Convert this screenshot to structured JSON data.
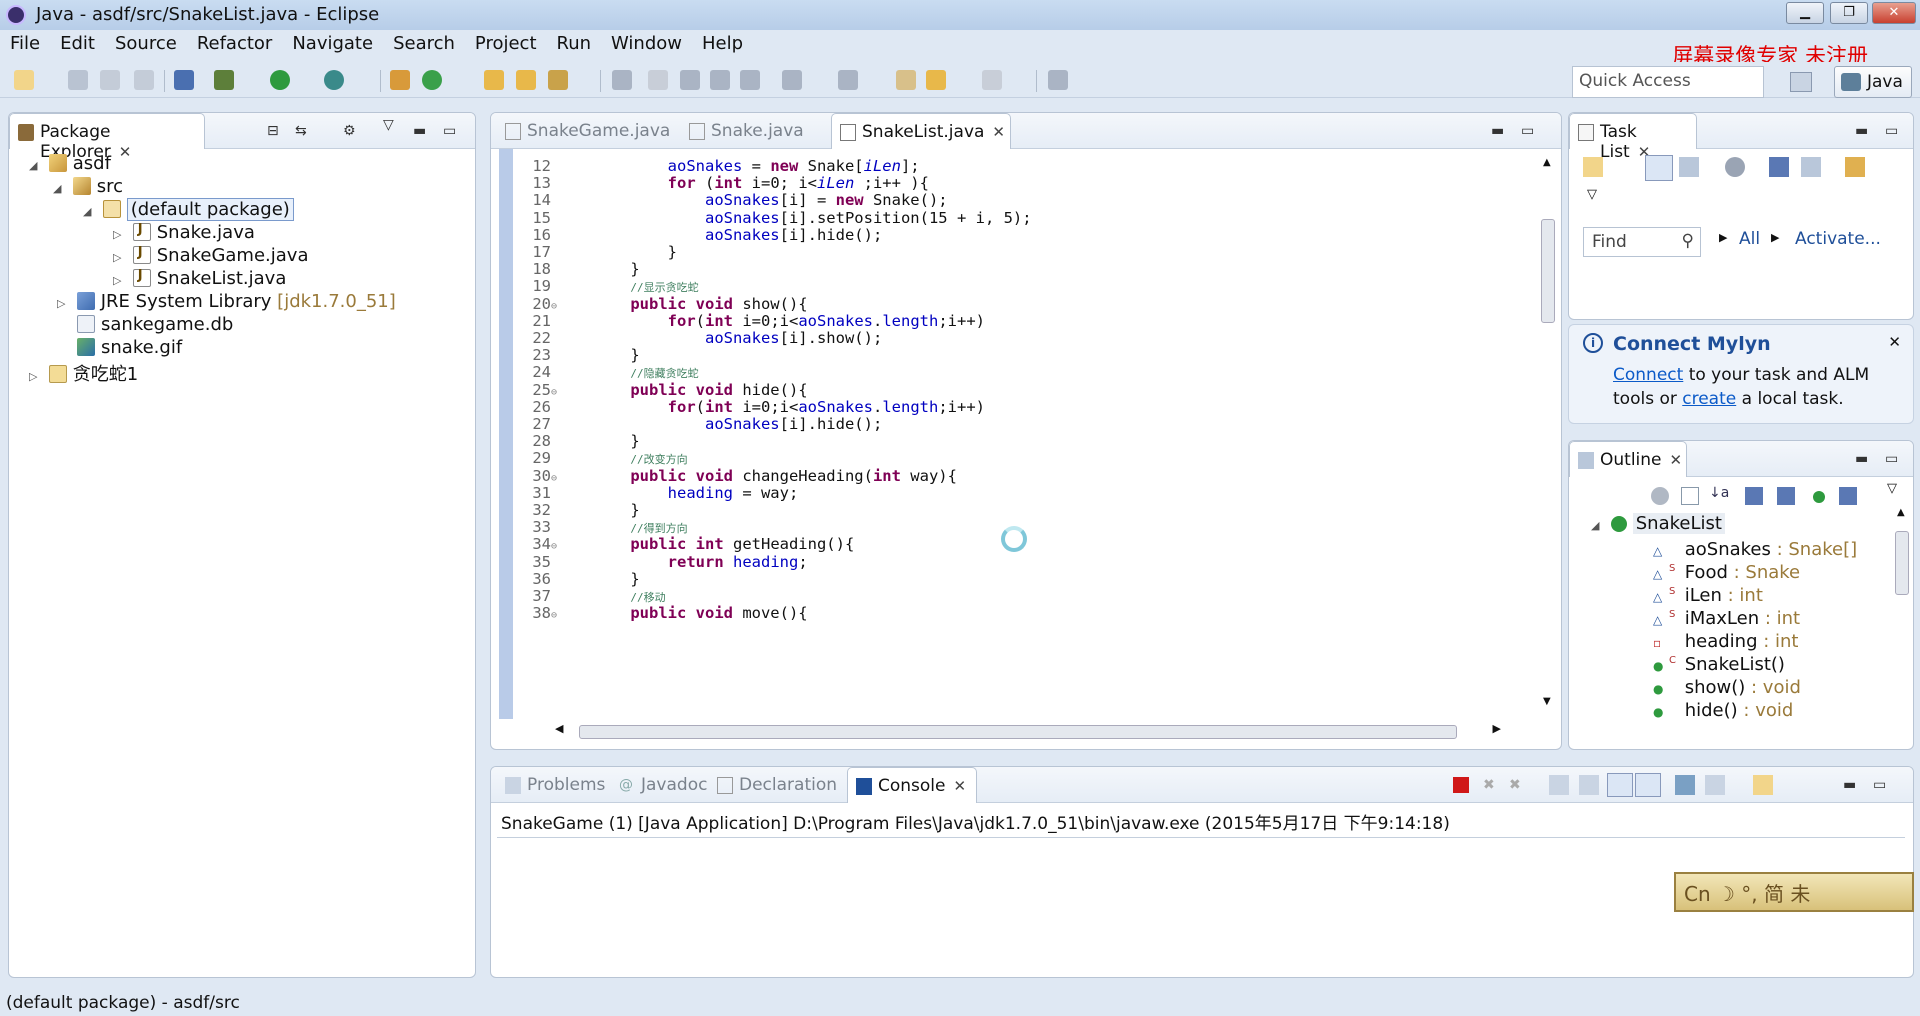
{
  "window": {
    "title": "Java - asdf/src/SnakeList.java - Eclipse"
  },
  "menu": [
    "File",
    "Edit",
    "Source",
    "Refactor",
    "Navigate",
    "Search",
    "Project",
    "Run",
    "Window",
    "Help"
  ],
  "watermark": "屏幕录像专家  未注册",
  "quick_access": {
    "placeholder": "Quick Access"
  },
  "perspective": {
    "label": "Java"
  },
  "package_explorer": {
    "tab_label": "Package Explorer",
    "tree": [
      {
        "label": "asdf",
        "extra": ""
      },
      {
        "label": "src",
        "extra": ""
      },
      {
        "label": "(default package)",
        "extra": ""
      },
      {
        "label": "Snake.java",
        "extra": ""
      },
      {
        "label": "SnakeGame.java",
        "extra": ""
      },
      {
        "label": "SnakeList.java",
        "extra": ""
      },
      {
        "label": "JRE System Library",
        "extra": "[jdk1.7.0_51]"
      },
      {
        "label": "sankegame.db",
        "extra": ""
      },
      {
        "label": "snake.gif",
        "extra": ""
      },
      {
        "label": "贪吃蛇1",
        "extra": ""
      }
    ]
  },
  "editor": {
    "tabs": [
      "SnakeGame.java",
      "Snake.java",
      "SnakeList.java"
    ],
    "active_tab": "SnakeList.java",
    "lines": [
      {
        "n": "12",
        "segs": [
          [
            "",
            "        "
          ],
          [
            "fld",
            "aoSnakes"
          ],
          [
            "",
            " = "
          ],
          [
            "kw",
            "new"
          ],
          [
            "",
            " Snake["
          ],
          [
            "sfld",
            "iLen"
          ],
          [
            "",
            "];"
          ]
        ]
      },
      {
        "n": "13",
        "segs": [
          [
            "",
            "        "
          ],
          [
            "kw",
            "for"
          ],
          [
            "",
            " ("
          ],
          [
            "kw",
            "int"
          ],
          [
            "",
            " i=0; i<"
          ],
          [
            "sfld",
            "iLen"
          ],
          [
            "",
            " ;i++ ){"
          ]
        ]
      },
      {
        "n": "14",
        "segs": [
          [
            "",
            "            "
          ],
          [
            "fld",
            "aoSnakes"
          ],
          [
            "",
            "[i] = "
          ],
          [
            "kw",
            "new"
          ],
          [
            "",
            " Snake();"
          ]
        ]
      },
      {
        "n": "15",
        "segs": [
          [
            "",
            "            "
          ],
          [
            "fld",
            "aoSnakes"
          ],
          [
            "",
            "[i].setPosition(15 + i, 5);"
          ]
        ]
      },
      {
        "n": "16",
        "segs": [
          [
            "",
            "            "
          ],
          [
            "fld",
            "aoSnakes"
          ],
          [
            "",
            "[i].hide();"
          ]
        ]
      },
      {
        "n": "17",
        "segs": [
          [
            "",
            "        }"
          ]
        ]
      },
      {
        "n": "18",
        "segs": [
          [
            "",
            "    }"
          ]
        ]
      },
      {
        "n": "19",
        "segs": [
          [
            "",
            "    "
          ],
          [
            "cmt",
            "//显示贪吃蛇"
          ]
        ]
      },
      {
        "n": "20",
        "fold": true,
        "segs": [
          [
            "",
            "    "
          ],
          [
            "kw",
            "public void"
          ],
          [
            "",
            " show(){"
          ]
        ]
      },
      {
        "n": "21",
        "segs": [
          [
            "",
            "        "
          ],
          [
            "kw",
            "for"
          ],
          [
            "",
            "("
          ],
          [
            "kw",
            "int"
          ],
          [
            "",
            " i=0;i<"
          ],
          [
            "fld",
            "aoSnakes"
          ],
          [
            "",
            "."
          ],
          [
            "fld",
            "length"
          ],
          [
            "",
            ";i++)"
          ]
        ]
      },
      {
        "n": "22",
        "segs": [
          [
            "",
            "            "
          ],
          [
            "fld",
            "aoSnakes"
          ],
          [
            "",
            "[i].show();"
          ]
        ]
      },
      {
        "n": "23",
        "segs": [
          [
            "",
            "    }"
          ]
        ]
      },
      {
        "n": "24",
        "segs": [
          [
            "",
            "    "
          ],
          [
            "cmt",
            "//隐藏贪吃蛇"
          ]
        ]
      },
      {
        "n": "25",
        "fold": true,
        "segs": [
          [
            "",
            "    "
          ],
          [
            "kw",
            "public void"
          ],
          [
            "",
            " hide(){"
          ]
        ]
      },
      {
        "n": "26",
        "segs": [
          [
            "",
            "        "
          ],
          [
            "kw",
            "for"
          ],
          [
            "",
            "("
          ],
          [
            "kw",
            "int"
          ],
          [
            "",
            " i=0;i<"
          ],
          [
            "fld",
            "aoSnakes"
          ],
          [
            "",
            "."
          ],
          [
            "fld",
            "length"
          ],
          [
            "",
            ";i++)"
          ]
        ]
      },
      {
        "n": "27",
        "segs": [
          [
            "",
            "            "
          ],
          [
            "fld",
            "aoSnakes"
          ],
          [
            "",
            "[i].hide();"
          ]
        ]
      },
      {
        "n": "28",
        "segs": [
          [
            "",
            "    }"
          ]
        ]
      },
      {
        "n": "29",
        "segs": [
          [
            "",
            "    "
          ],
          [
            "cmt",
            "//改变方向"
          ]
        ]
      },
      {
        "n": "30",
        "fold": true,
        "segs": [
          [
            "",
            "    "
          ],
          [
            "kw",
            "public void"
          ],
          [
            "",
            " changeHeading("
          ],
          [
            "kw",
            "int"
          ],
          [
            "",
            " way){"
          ]
        ]
      },
      {
        "n": "31",
        "segs": [
          [
            "",
            "        "
          ],
          [
            "fld",
            "heading"
          ],
          [
            "",
            " = way;"
          ]
        ]
      },
      {
        "n": "32",
        "segs": [
          [
            "",
            "    }"
          ]
        ]
      },
      {
        "n": "33",
        "segs": [
          [
            "",
            "    "
          ],
          [
            "cmt",
            "//得到方向"
          ]
        ]
      },
      {
        "n": "34",
        "fold": true,
        "segs": [
          [
            "",
            "    "
          ],
          [
            "kw",
            "public int"
          ],
          [
            "",
            " getHeading(){"
          ]
        ]
      },
      {
        "n": "35",
        "segs": [
          [
            "",
            "        "
          ],
          [
            "kw",
            "return"
          ],
          [
            "",
            " "
          ],
          [
            "fld",
            "heading"
          ],
          [
            "",
            ";"
          ]
        ]
      },
      {
        "n": "36",
        "segs": [
          [
            "",
            "    }"
          ]
        ]
      },
      {
        "n": "37",
        "segs": [
          [
            "",
            "    "
          ],
          [
            "cmt",
            "//移动"
          ]
        ]
      },
      {
        "n": "38",
        "fold": true,
        "segs": [
          [
            "",
            "    "
          ],
          [
            "kw",
            "public void"
          ],
          [
            "",
            " move(){"
          ]
        ]
      }
    ]
  },
  "task_list": {
    "tab_label": "Task List",
    "find_placeholder": "Find",
    "all_label": "All",
    "activate_label": "Activate..."
  },
  "mylyn": {
    "title": "Connect Mylyn",
    "connect": "Connect",
    "text1": " to your task and ALM",
    "text2a": "tools or ",
    "create": "create",
    "text2b": " a local task."
  },
  "outline": {
    "tab_label": "Outline",
    "root": "SnakeList",
    "items": [
      {
        "name": "aoSnakes",
        "type": " : Snake[]",
        "mod": ""
      },
      {
        "name": "Food",
        "type": " : Snake",
        "mod": "S"
      },
      {
        "name": "iLen",
        "type": " : int",
        "mod": "S"
      },
      {
        "name": "iMaxLen",
        "type": " : int",
        "mod": "S"
      },
      {
        "name": "heading",
        "type": " : int",
        "mod": ""
      },
      {
        "name": "SnakeList()",
        "type": "",
        "mod": "C"
      },
      {
        "name": "show()",
        "type": " : void",
        "mod": ""
      },
      {
        "name": "hide()",
        "type": " : void",
        "mod": ""
      }
    ]
  },
  "bottom": {
    "tabs": [
      "Problems",
      "Javadoc",
      "Declaration",
      "Console"
    ],
    "active_tab": "Console",
    "console_header": "SnakeGame (1) [Java Application] D:\\Program Files\\Java\\jdk1.7.0_51\\bin\\javaw.exe (2015年5月17日 下午9:14:18)"
  },
  "ime": {
    "label": "Cn ☽ °, 简 未"
  },
  "statusbar": {
    "text": "(default package) - asdf/src"
  },
  "colors": {
    "window_bg": "#dfe8f3",
    "keyword": "#7f0055",
    "field": "#0000c0",
    "comment": "#3f7f5f",
    "watermark": "#e00000"
  }
}
